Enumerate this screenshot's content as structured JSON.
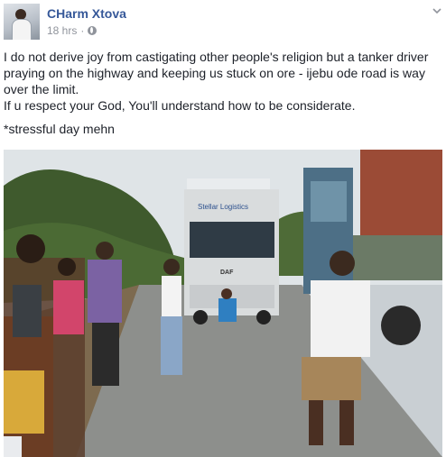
{
  "post": {
    "author": "CHarm Xtova",
    "timestamp": "18 hrs",
    "separator": "·",
    "privacy_icon": "globe-icon",
    "menu_icon": "chevron-down-icon",
    "paragraph_1": "I do not derive joy from castigating other people's religion but a tanker driver praying on the highway and keeping us stuck on ore - ijebu ode road is way over the limit.",
    "paragraph_2": "If u respect your God, You'll understand how to be considerate.",
    "paragraph_3": "*stressful day mehn",
    "photo": {
      "truck_sign": "Stellar Logistics",
      "truck_brand": "DAF"
    }
  },
  "colors": {
    "author": "#365899",
    "meta": "#90949c",
    "text": "#1d2129"
  }
}
